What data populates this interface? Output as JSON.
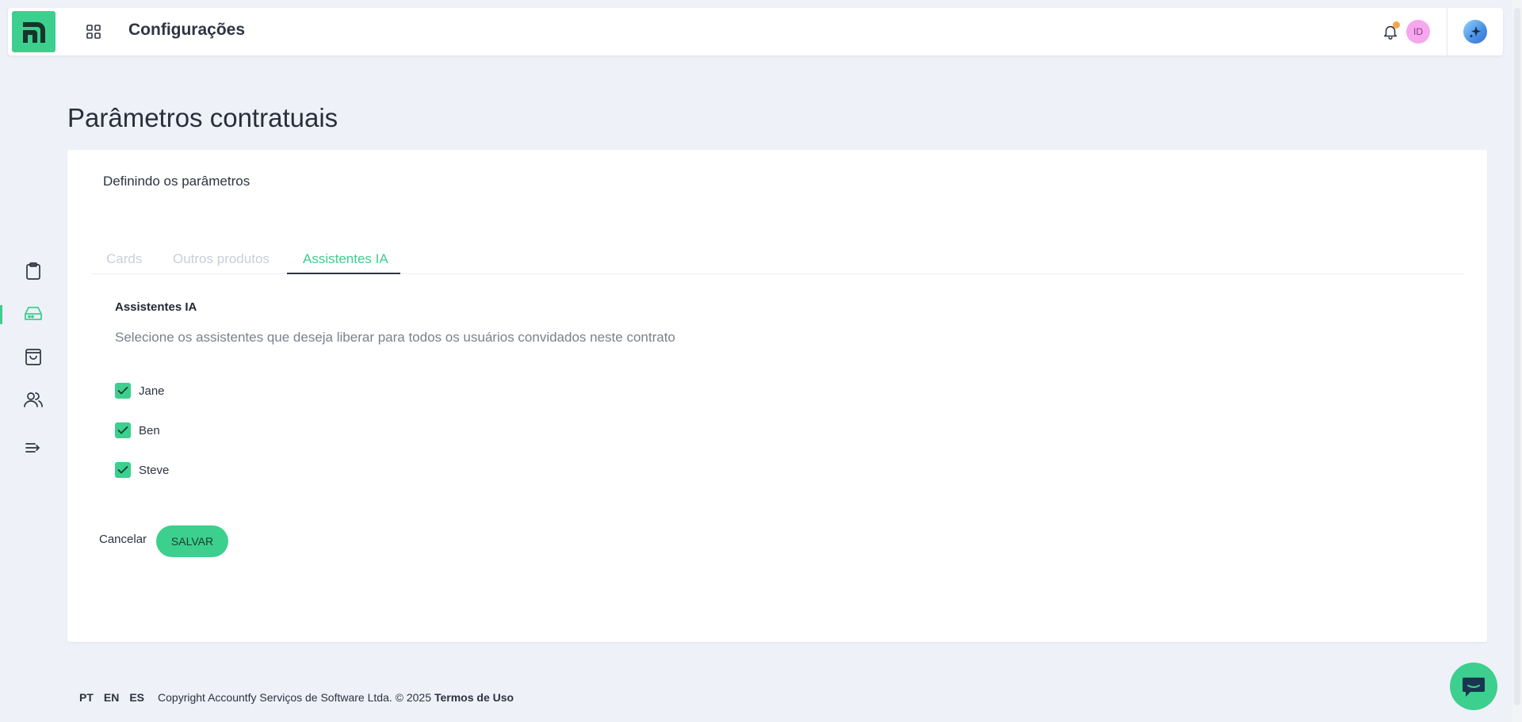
{
  "header": {
    "title": "Configurações",
    "avatar_initials": "ID",
    "brand_color": "#3ccf8e",
    "notification_dot_color": "#f6a54b"
  },
  "sidebar": {
    "items": [
      {
        "name": "clipboard",
        "icon": "clipboard-icon",
        "active": false
      },
      {
        "name": "drive",
        "icon": "drive-icon",
        "active": true
      },
      {
        "name": "shopping-bag",
        "icon": "shopping-bag-icon",
        "active": false
      },
      {
        "name": "users",
        "icon": "users-icon",
        "active": false
      },
      {
        "name": "expand-menu",
        "icon": "expand-menu-icon",
        "active": false
      }
    ]
  },
  "page": {
    "title": "Parâmetros contratuais"
  },
  "card": {
    "subtitle": "Definindo os parâmetros",
    "tabs": [
      {
        "label": "Cards",
        "active": false
      },
      {
        "label": "Outros produtos",
        "active": false
      },
      {
        "label": "Assistentes IA",
        "active": true
      }
    ],
    "section_title": "Assistentes IA",
    "section_desc": "Selecione os assistentes que deseja liberar para todos os usuários convidados neste contrato",
    "assistants": [
      {
        "label": "Jane",
        "checked": true
      },
      {
        "label": "Ben",
        "checked": true
      },
      {
        "label": "Steve",
        "checked": true
      }
    ],
    "cancel_label": "Cancelar",
    "save_label": "SALVAR"
  },
  "footer": {
    "languages": [
      "PT",
      "EN",
      "ES"
    ],
    "copyright": "Copyright Accountfy Serviços de Software Ltda. © 2025",
    "terms_label": "Termos de Uso"
  }
}
